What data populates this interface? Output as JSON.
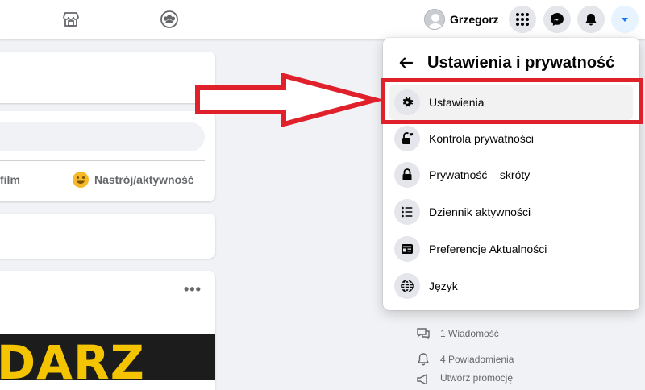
{
  "topbar": {
    "nav_icons": [
      "marketplace-icon",
      "groups-icon"
    ],
    "profile_name": "Grzegorz",
    "action_buttons": [
      "menu-grid-icon",
      "messenger-icon",
      "notifications-icon",
      "account-caret-icon"
    ]
  },
  "feed": {
    "composer_actions": {
      "film_label": "film",
      "mood_label": "Nastrój/aktywność"
    },
    "post_more_label": "•••",
    "promo_text": "DARZ"
  },
  "sidebar": {
    "links": [
      {
        "label": "1 Wiadomość",
        "icon": "message-icon"
      },
      {
        "label": "4 Powiadomienia",
        "icon": "bell-icon"
      },
      {
        "label": "Utwórz promocję",
        "icon": "megaphone-icon"
      }
    ]
  },
  "settings_menu": {
    "title": "Ustawienia i prywatność",
    "items": [
      {
        "label": "Ustawienia",
        "icon": "gear-icon"
      },
      {
        "label": "Kontrola prywatności",
        "icon": "lock-heart-icon"
      },
      {
        "label": "Prywatność – skróty",
        "icon": "lock-icon"
      },
      {
        "label": "Dziennik aktywności",
        "icon": "list-icon"
      },
      {
        "label": "Preferencje Aktualności",
        "icon": "news-feed-icon"
      },
      {
        "label": "Język",
        "icon": "globe-icon"
      }
    ]
  },
  "colors": {
    "annotation_red": "#e0202a",
    "brand_blue": "#1877f2",
    "promo_yellow": "#f5c400"
  }
}
